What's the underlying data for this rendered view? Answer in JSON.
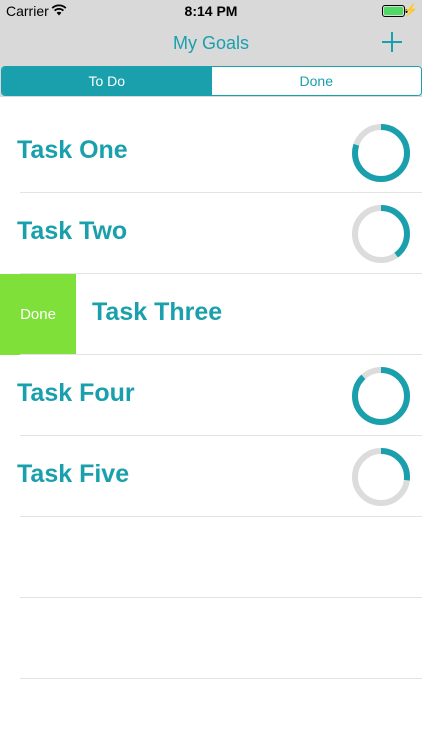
{
  "status_bar": {
    "carrier": "Carrier",
    "time": "8:14 PM"
  },
  "nav": {
    "title": "My Goals"
  },
  "segments": {
    "todo": "To Do",
    "done": "Done",
    "selected": "To Do"
  },
  "tasks": [
    {
      "title": "Task One",
      "progress": 0.8
    },
    {
      "title": "Task Two",
      "progress": 0.4
    },
    {
      "title": "Task Three",
      "swipe_action": "Done"
    },
    {
      "title": "Task Four",
      "progress": 0.88
    },
    {
      "title": "Task Five",
      "progress": 0.27
    }
  ],
  "colors": {
    "accent": "#1aa0ac",
    "ring_track": "#dcdcdc",
    "swipe_done": "#7fe03a",
    "battery": "#4cd964",
    "bar_bg": "#d9d9d9"
  },
  "icons": {
    "signal": "wifi-icon",
    "battery": "battery-icon",
    "charging": "charging-bolt-icon",
    "add": "plus-icon"
  }
}
